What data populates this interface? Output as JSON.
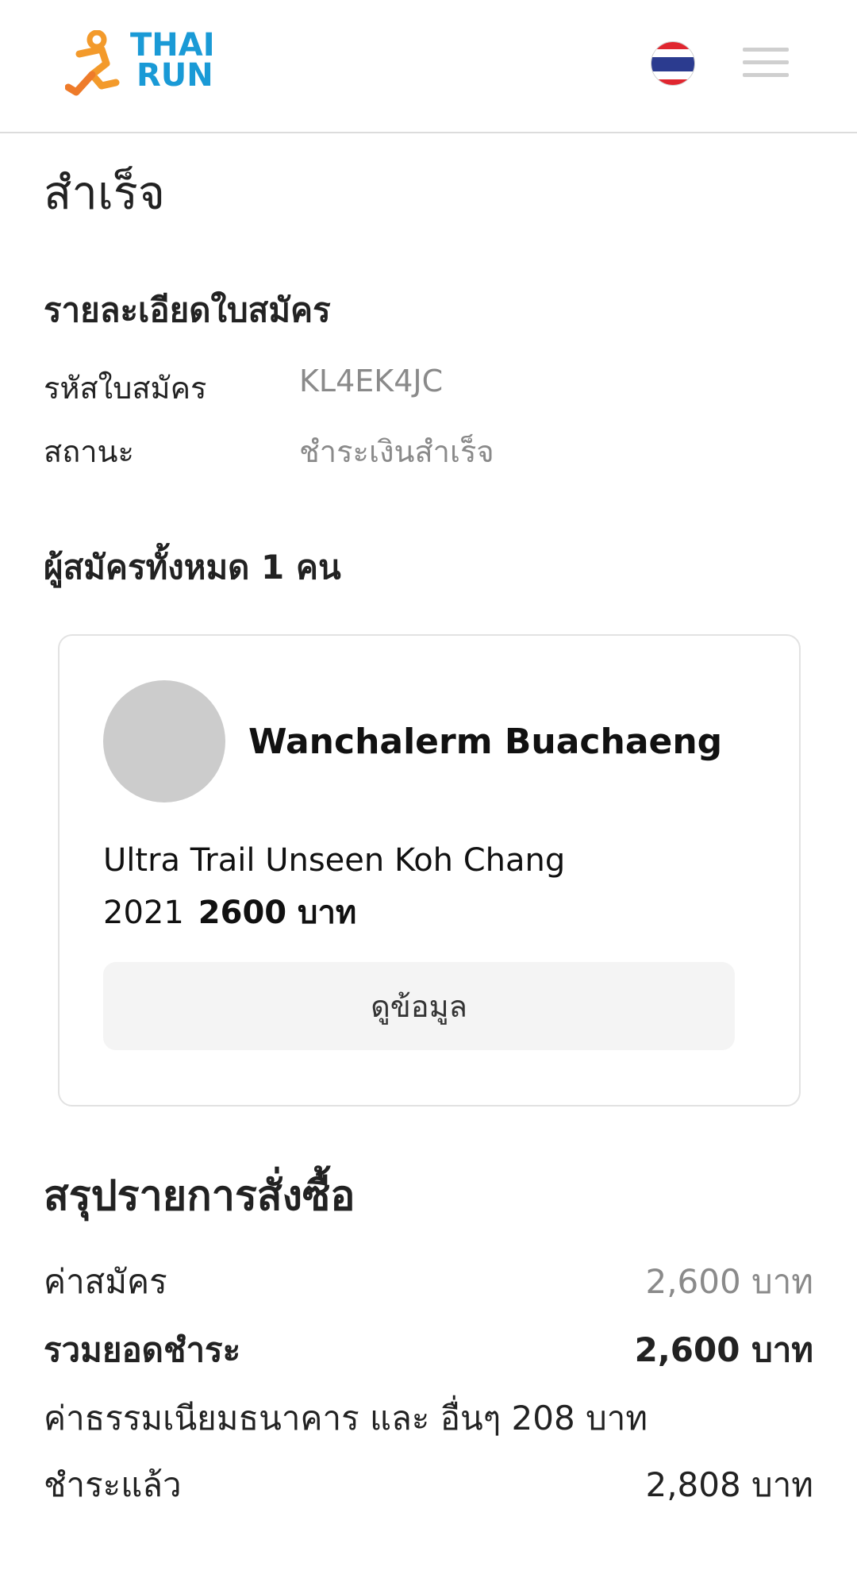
{
  "header": {
    "logo": {
      "line1": "THAI",
      "line2": "RUN",
      "brand_blue": "#1a9ad6",
      "brand_orange": "#f39a2b"
    },
    "language_flag": "thailand-flag-icon",
    "menu_icon": "hamburger-menu-icon"
  },
  "page_title": "สำเร็จ",
  "application": {
    "heading": "รายละเอียดใบสมัคร",
    "rows": [
      {
        "label": "รหัสใบสมัคร",
        "value": "KL4EK4JC"
      },
      {
        "label": "สถานะ",
        "value": "ชำระเงินสำเร็จ"
      }
    ]
  },
  "participants": {
    "heading": "ผู้สมัครทั้งหมด 1 คน",
    "items": [
      {
        "name": "Wanchalerm Buachaeng",
        "race": "Ultra Trail Unseen Koh Chang 2021",
        "price": "2600 บาท",
        "view_button": "ดูข้อมูล"
      }
    ]
  },
  "summary": {
    "heading": "สรุปรายการสั่งซื้อ",
    "registration_fee_label": "ค่าสมัคร",
    "registration_fee_value": "2,600 บาท",
    "total_label": "รวมยอดชำระ",
    "total_value": "2,600 บาท",
    "bank_fee_note": "ค่าธรรมเนียมธนาคาร และ อื่นๆ 208 บาท",
    "paid_label": "ชำระแล้ว",
    "paid_value": "2,808 บาท"
  }
}
